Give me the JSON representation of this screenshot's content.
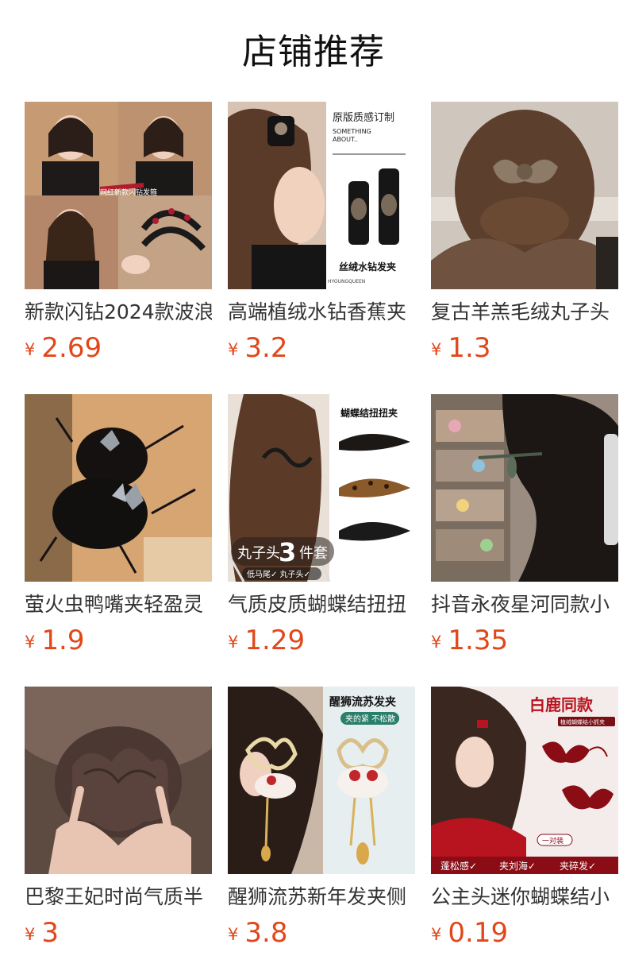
{
  "page": {
    "title": "店铺推荐"
  },
  "currency_symbol": "¥",
  "products": [
    {
      "name": "新款闪钻2024款波浪",
      "price": "2.69",
      "image": {
        "overlay_texts": [
          "网红新款闪钻发箍"
        ]
      }
    },
    {
      "name": "高端植绒水钻香蕉夹",
      "price": "3.2",
      "image": {
        "overlay_texts": [
          "原版质感订制",
          "SOMETHING",
          "ABOUT..",
          "丝绒水钻发夹",
          "HYOUNGQUEEN"
        ]
      }
    },
    {
      "name": "复古羊羔毛绒丸子头",
      "price": "1.3",
      "image": {
        "overlay_texts": []
      }
    },
    {
      "name": "萤火虫鸭嘴夹轻盈灵",
      "price": "1.9",
      "image": {
        "overlay_texts": []
      }
    },
    {
      "name": "气质皮质蝴蝶结扭扭",
      "price": "1.29",
      "image": {
        "overlay_texts": [
          "蝴蝶结扭扭夹",
          "丸子头",
          "3",
          "件套",
          "低马尾✓ 丸子头✓"
        ]
      }
    },
    {
      "name": "抖音永夜星河同款小",
      "price": "1.35",
      "image": {
        "overlay_texts": []
      }
    },
    {
      "name": "巴黎王妃时尚气质半",
      "price": "3",
      "image": {
        "overlay_texts": []
      }
    },
    {
      "name": "醒狮流苏新年发夹侧",
      "price": "3.8",
      "image": {
        "overlay_texts": [
          "醒狮流苏发夹",
          "夹的紧 不松散"
        ]
      }
    },
    {
      "name": "公主头迷你蝴蝶结小",
      "price": "0.19",
      "image": {
        "overlay_texts": [
          "白鹿同款",
          "植绒蝴蝶结小抓夹",
          "一对装",
          "蓬松感✓",
          "夹刘海✓",
          "夹碎发✓"
        ]
      }
    }
  ]
}
